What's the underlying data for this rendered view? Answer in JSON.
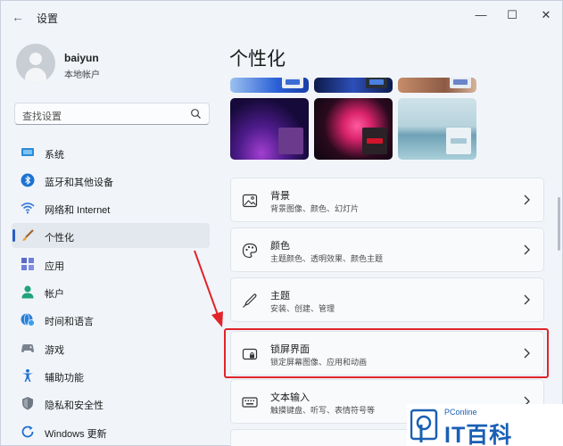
{
  "window": {
    "title": "设置",
    "back_icon": "back-arrow-icon",
    "controls": [
      "minimize-icon",
      "maximize-icon",
      "close-icon"
    ]
  },
  "user": {
    "name": "baiyun",
    "account_type": "本地帐户"
  },
  "search": {
    "placeholder": "查找设置"
  },
  "sidebar": {
    "items": [
      {
        "label": "系统",
        "icon": "monitor-icon",
        "active": false
      },
      {
        "label": "蓝牙和其他设备",
        "icon": "bluetooth-icon",
        "active": false
      },
      {
        "label": "网络和 Internet",
        "icon": "wifi-icon",
        "active": false
      },
      {
        "label": "个性化",
        "icon": "brush-icon",
        "active": true
      },
      {
        "label": "应用",
        "icon": "apps-icon",
        "active": false
      },
      {
        "label": "帐户",
        "icon": "person-icon",
        "active": false
      },
      {
        "label": "时间和语言",
        "icon": "globe-clock-icon",
        "active": false
      },
      {
        "label": "游戏",
        "icon": "gamepad-icon",
        "active": false
      },
      {
        "label": "辅助功能",
        "icon": "accessibility-icon",
        "active": false
      },
      {
        "label": "隐私和安全性",
        "icon": "shield-icon",
        "active": false
      },
      {
        "label": "Windows 更新",
        "icon": "update-icon",
        "active": false
      }
    ]
  },
  "main": {
    "title": "个性化",
    "cards": [
      {
        "title": "背景",
        "subtitle": "背景图像、颜色、幻灯片",
        "icon": "image-icon"
      },
      {
        "title": "颜色",
        "subtitle": "主题颜色、透明效果、颜色主题",
        "icon": "palette-icon"
      },
      {
        "title": "主题",
        "subtitle": "安装、创建、管理",
        "icon": "pen-icon"
      },
      {
        "title": "锁屏界面",
        "subtitle": "锁定屏幕图像、应用和动画",
        "icon": "lock-screen-icon",
        "highlighted": true
      },
      {
        "title": "文本输入",
        "subtitle": "触摸键盘、听写、表情符号等",
        "icon": "keyboard-icon"
      }
    ]
  },
  "watermark": {
    "small_text": "PConline",
    "big_text": "IT百科"
  },
  "colors": {
    "accent": "#2a5ec4",
    "highlight": "#e0242a"
  }
}
